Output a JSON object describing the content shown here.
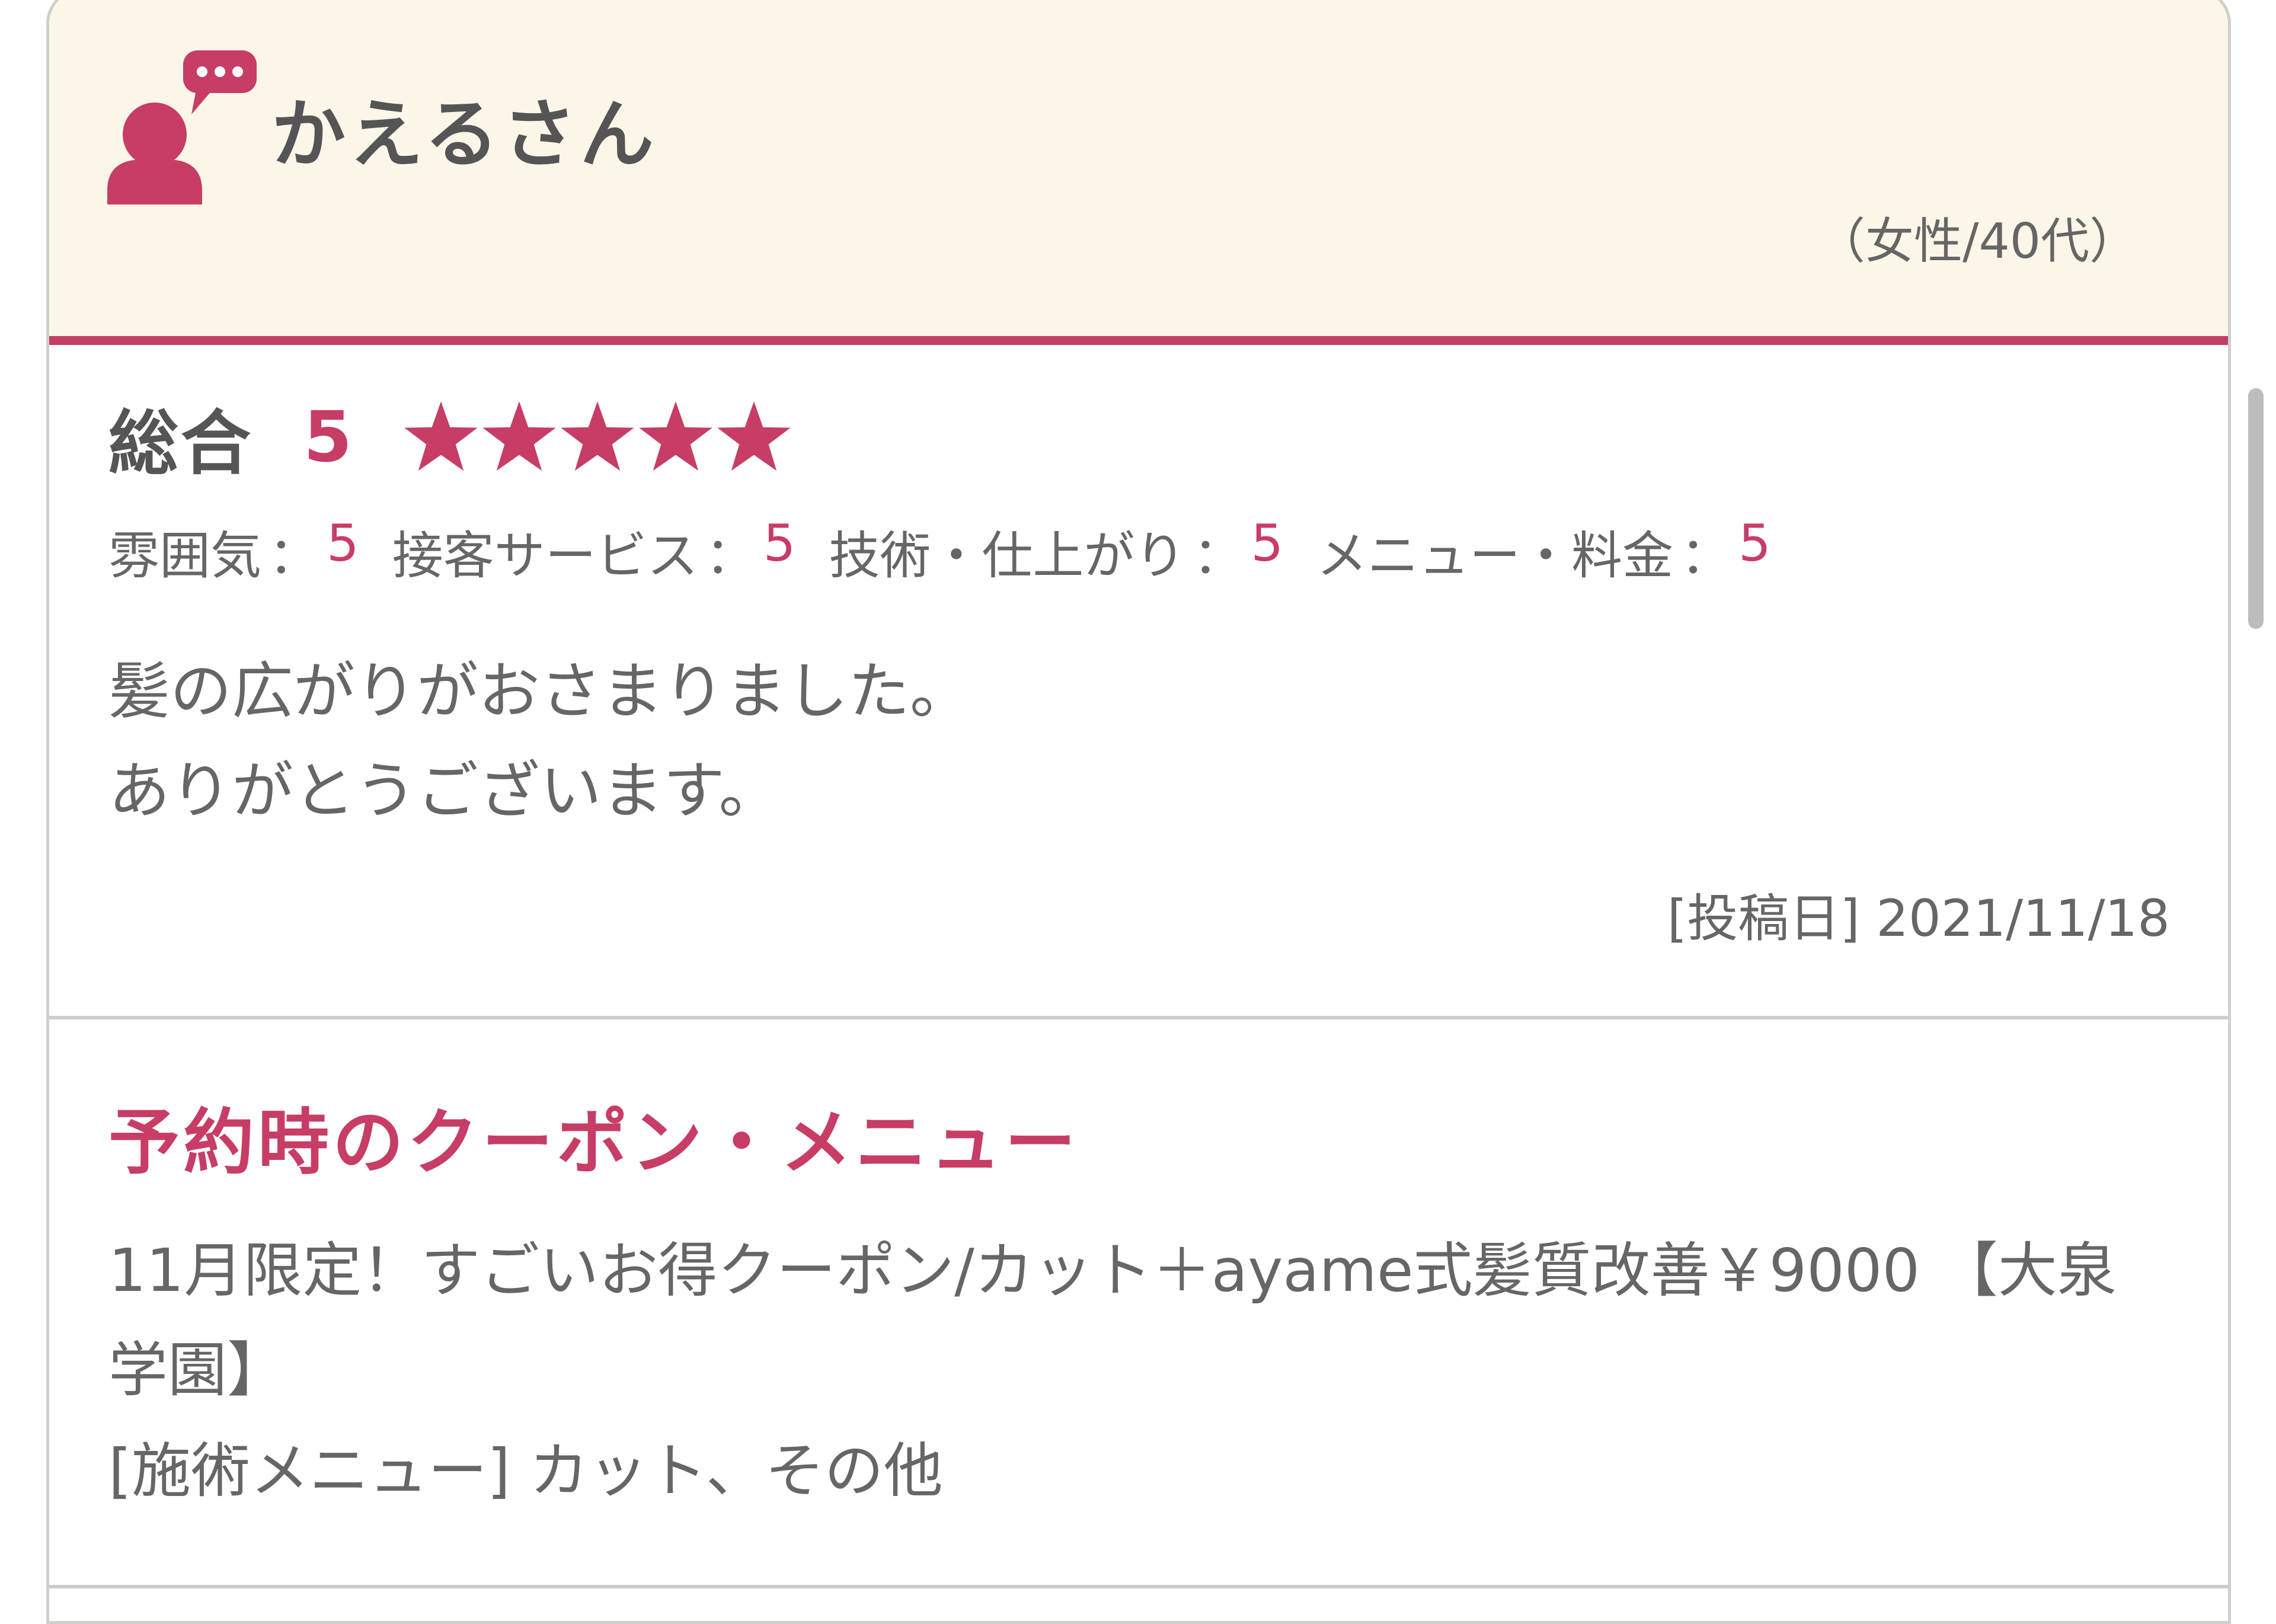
{
  "reviewer": {
    "name": "かえるさん",
    "meta": "（女性/40代）"
  },
  "rating": {
    "overall_label": "総合",
    "overall_score": "5",
    "stars": 5,
    "subratings": [
      {
        "label": "雰囲気",
        "value": "5"
      },
      {
        "label": "接客サービス",
        "value": "5"
      },
      {
        "label": "技術・仕上がり",
        "value": "5"
      },
      {
        "label": "メニュー・料金",
        "value": "5"
      }
    ],
    "colon": "：",
    "comment_lines": [
      "髪の広がりがおさまりました。",
      "ありがとうございます。"
    ],
    "post_date": "[投稿日] 2021/11/18"
  },
  "coupon": {
    "heading": "予約時のクーポン・メニュー",
    "name": "11月限定！すごいお得クーポン/カット＋ayame式髪質改善￥9000 【大泉学園】",
    "menu": "[施術メニュー] カット、その他"
  },
  "colors": {
    "accent": "#c73d66",
    "header_bg": "#fbf6e8",
    "text": "#666666"
  },
  "icons": {
    "user": "reviewer-speech-icon",
    "star": "star-icon"
  }
}
